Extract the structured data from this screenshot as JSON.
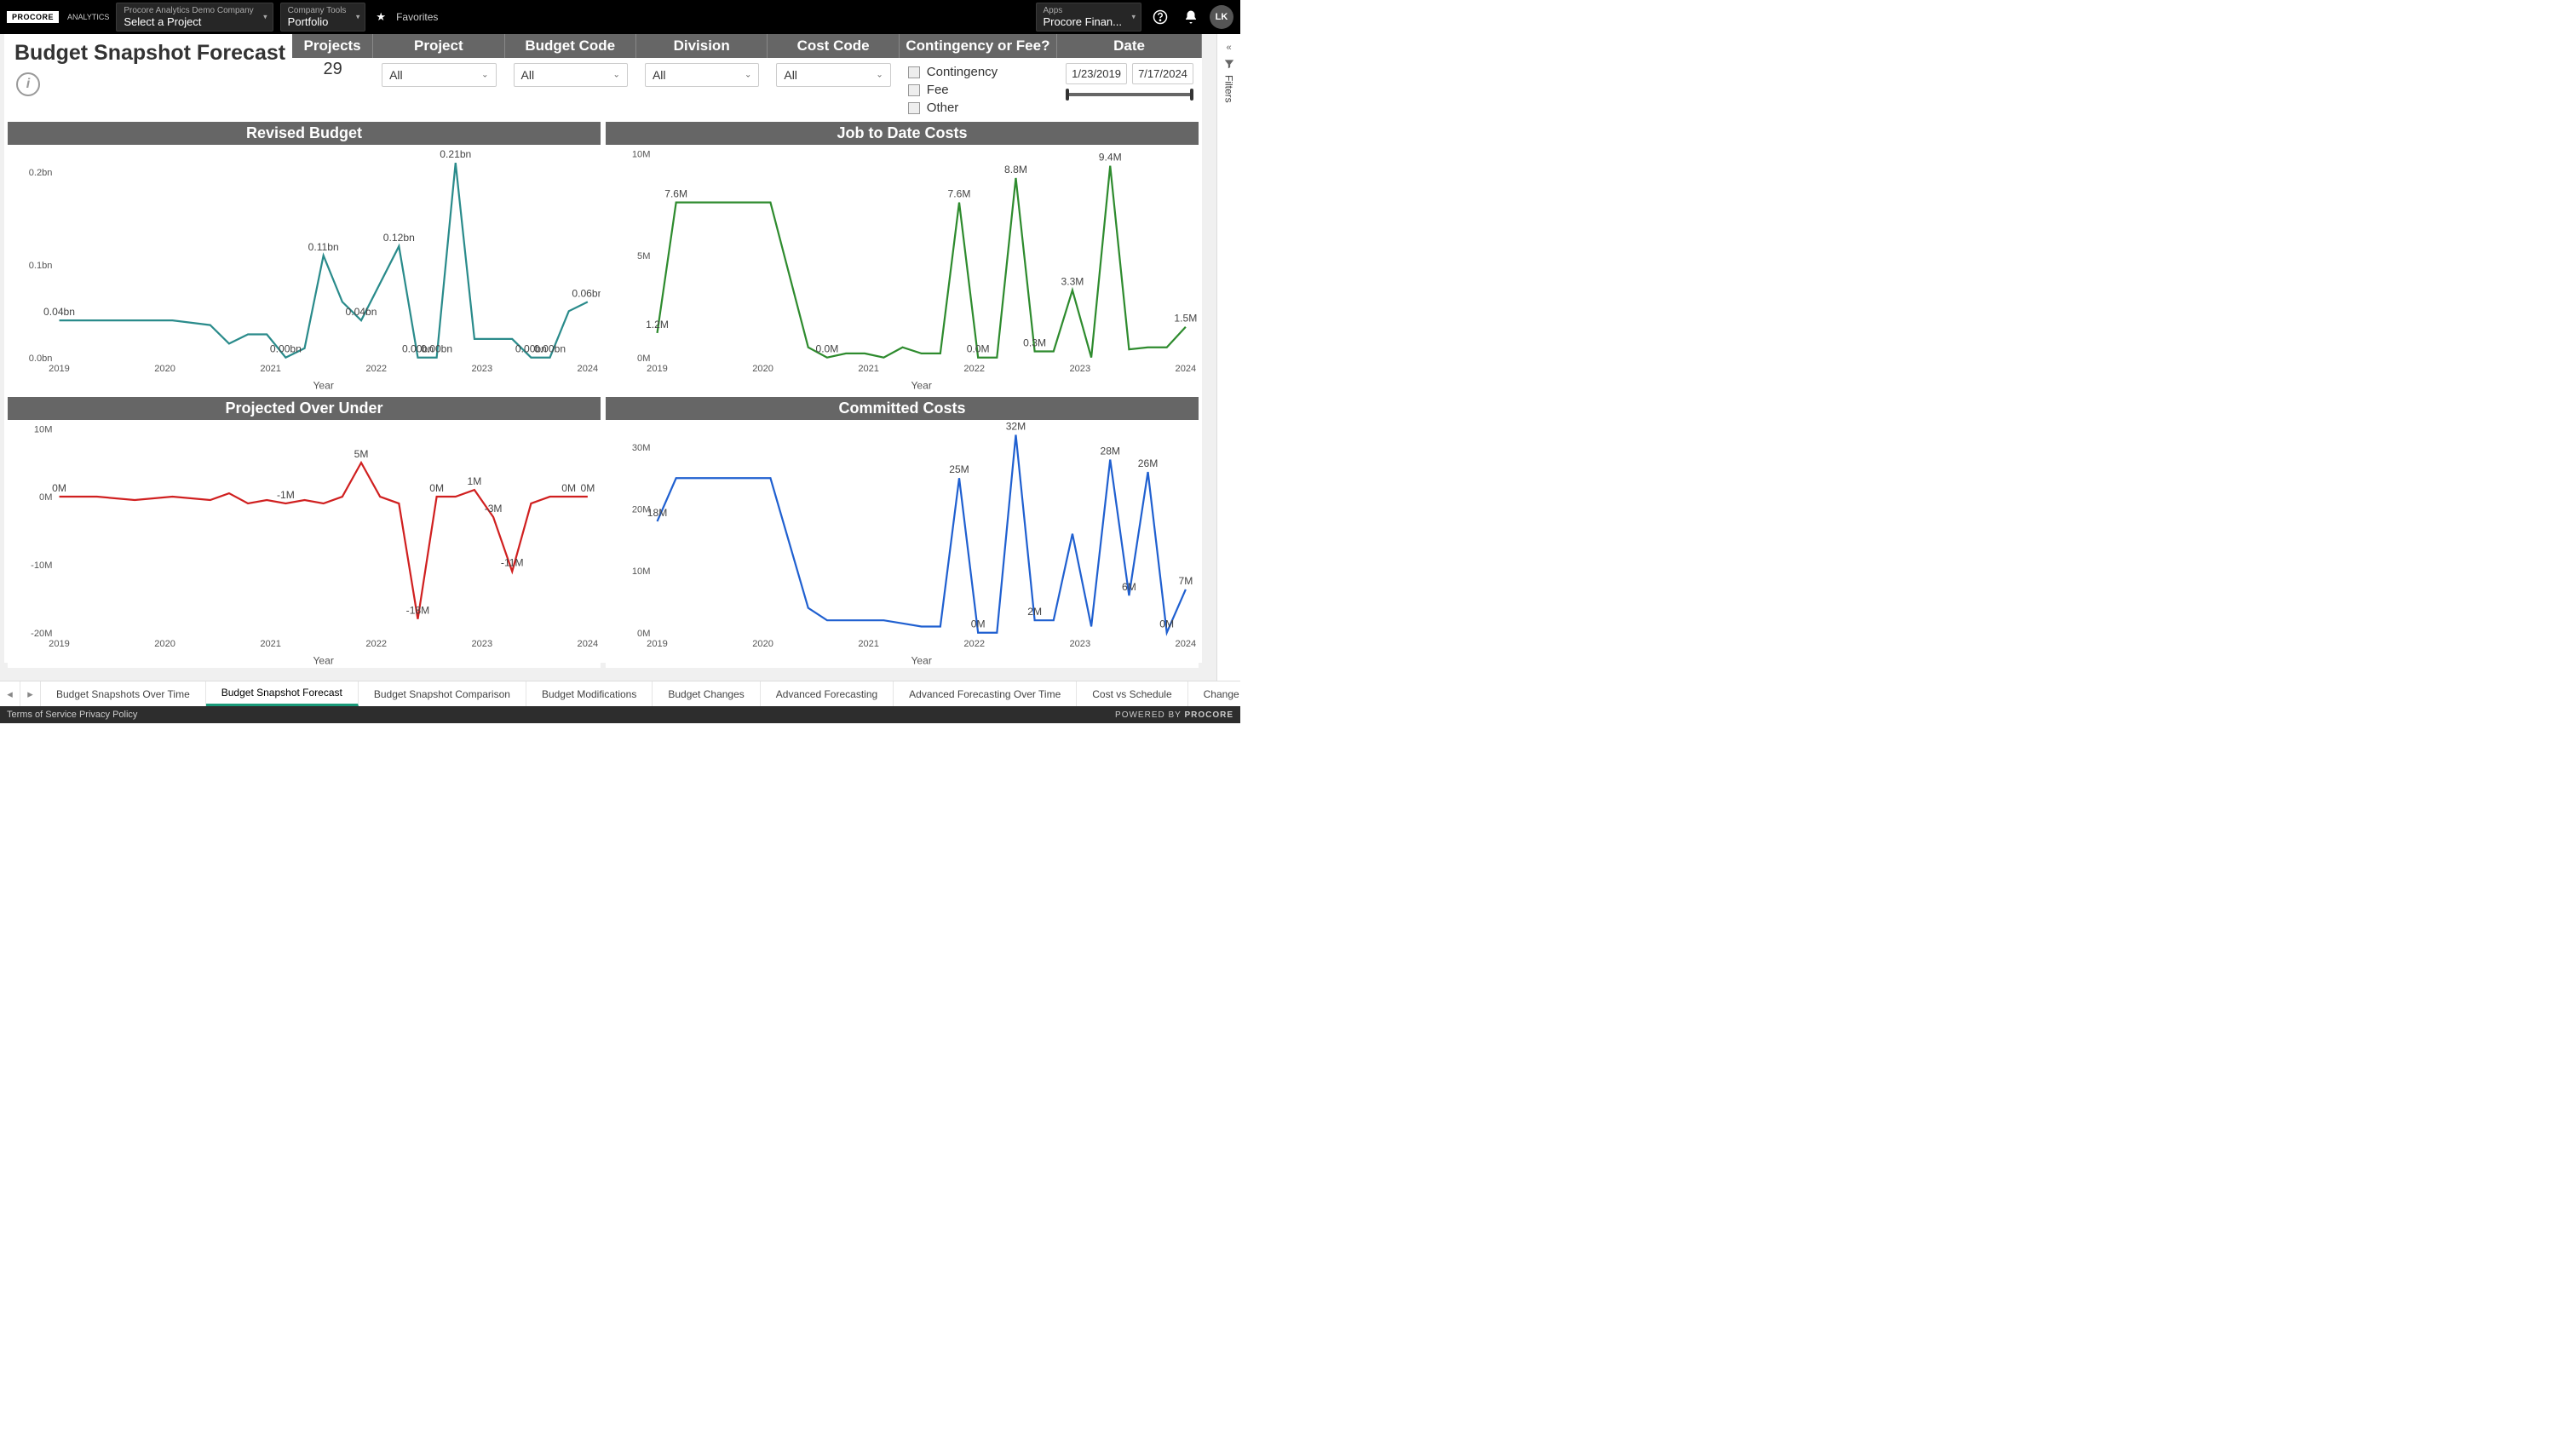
{
  "topbar": {
    "logo": "PROCORE",
    "logo_sub": "ANALYTICS",
    "company_dd": {
      "label": "Procore Analytics Demo Company",
      "value": "Select a Project"
    },
    "tools_dd": {
      "label": "Company Tools",
      "value": "Portfolio"
    },
    "favorites": "Favorites",
    "apps_dd": {
      "label": "Apps",
      "value": "Procore Finan..."
    },
    "avatar": "LK"
  },
  "page_title": "Budget Snapshot Forecast",
  "filters": {
    "projects": {
      "header": "Projects",
      "count": "29"
    },
    "project": {
      "header": "Project",
      "value": "All"
    },
    "budget_code": {
      "header": "Budget Code",
      "value": "All"
    },
    "division": {
      "header": "Division",
      "value": "All"
    },
    "cost_code": {
      "header": "Cost Code",
      "value": "All"
    },
    "contingency": {
      "header": "Contingency or Fee?",
      "options": [
        "Contingency",
        "Fee",
        "Other"
      ]
    },
    "date": {
      "header": "Date",
      "from": "1/23/2019",
      "to": "7/17/2024"
    }
  },
  "filters_pane": "Filters",
  "chart_data": [
    {
      "id": "revised_budget",
      "title": "Revised Budget",
      "type": "line",
      "color": "#2a8b8b",
      "xlabel": "Year",
      "ylabel": "",
      "ylim": [
        0,
        0.22
      ],
      "yticks": [
        0.0,
        0.1,
        0.2
      ],
      "ytick_labels": [
        "0.0bn",
        "0.1bn",
        "0.2bn"
      ],
      "xticks": [
        "2019",
        "2020",
        "2021",
        "2022",
        "2023",
        "2024"
      ],
      "x": [
        0,
        1,
        2,
        3,
        4,
        4.5,
        5,
        5.5,
        6,
        6.5,
        7,
        7.5,
        8,
        9,
        9.5,
        10,
        10.5,
        11,
        12,
        12.5,
        13,
        13.5,
        14
      ],
      "y": [
        0.04,
        0.04,
        0.04,
        0.04,
        0.035,
        0.015,
        0.025,
        0.025,
        0.0,
        0.01,
        0.11,
        0.06,
        0.04,
        0.12,
        0.0,
        0.0,
        0.21,
        0.02,
        0.02,
        0.0,
        0.0,
        0.05,
        0.06
      ],
      "point_labels": {
        "0": "0.04bn",
        "8": "0.00bn",
        "10": "0.11bn",
        "12": "0.04bn",
        "13": "0.12bn",
        "14": "0.00bn",
        "15": "0.00bn",
        "16": "0.21bn",
        "19": "0.00bn",
        "20": "0.00bn",
        "22": "0.06bn"
      }
    },
    {
      "id": "jtd_costs",
      "title": "Job to Date Costs",
      "type": "line",
      "color": "#2e8b2e",
      "xlabel": "Year",
      "ylim": [
        0,
        10
      ],
      "yticks": [
        0,
        5,
        10
      ],
      "ytick_labels": [
        "0M",
        "5M",
        "10M"
      ],
      "xticks": [
        "2019",
        "2020",
        "2021",
        "2022",
        "2023",
        "2024"
      ],
      "x": [
        0,
        0.5,
        1,
        2,
        3,
        4,
        4.5,
        5,
        5.5,
        6,
        6.5,
        7,
        7.5,
        8,
        8.5,
        9,
        9.5,
        10,
        10.5,
        11,
        11.5,
        12,
        12.5,
        13,
        13.5,
        14
      ],
      "y": [
        1.2,
        7.6,
        7.6,
        7.6,
        7.6,
        0.5,
        0.0,
        0.2,
        0.2,
        0.0,
        0.5,
        0.2,
        0.2,
        7.6,
        0.0,
        0.0,
        8.8,
        0.3,
        0.3,
        3.3,
        0.0,
        9.4,
        0.4,
        0.5,
        0.5,
        1.5
      ],
      "point_labels": {
        "0": "1.2M",
        "1": "7.6M",
        "6": "0.0M",
        "8": "",
        "13": "7.6M",
        "14": "0.0M",
        "16": "8.8M",
        "17": "0.3M",
        "19": "3.3M",
        "21": "9.4M",
        "25": "1.5M"
      }
    },
    {
      "id": "proj_over_under",
      "title": "Projected Over Under",
      "type": "line",
      "color": "#d02020",
      "xlabel": "Year",
      "ylim": [
        -20,
        10
      ],
      "yticks": [
        -20,
        -10,
        0,
        10
      ],
      "ytick_labels": [
        "-20M",
        "-10M",
        "0M",
        "10M"
      ],
      "xticks": [
        "2019",
        "2020",
        "2021",
        "2022",
        "2023",
        "2024"
      ],
      "x": [
        0,
        1,
        2,
        3,
        4,
        4.5,
        5,
        5.5,
        6,
        6.5,
        7,
        7.5,
        8,
        8.5,
        9,
        9.5,
        10,
        10.5,
        11,
        11.5,
        12,
        12.5,
        13,
        13.5,
        14
      ],
      "y": [
        0,
        0,
        -0.5,
        0,
        -0.5,
        0.5,
        -1,
        -0.5,
        -1,
        -0.5,
        -1,
        0,
        5,
        0,
        -1,
        -18,
        0,
        0,
        1,
        -3,
        -11,
        -1,
        0,
        0,
        0
      ],
      "point_labels": {
        "0": "0M",
        "8": "-1M",
        "12": "5M",
        "15": "-18M",
        "16": "0M",
        "18": "1M",
        "19": "-3M",
        "20": "-11M",
        "23": "0M",
        "24": "0M"
      }
    },
    {
      "id": "committed_costs",
      "title": "Committed Costs",
      "type": "line",
      "color": "#2060d0",
      "xlabel": "Year",
      "ylim": [
        0,
        33
      ],
      "yticks": [
        0,
        10,
        20,
        30
      ],
      "ytick_labels": [
        "0M",
        "10M",
        "20M",
        "30M"
      ],
      "xticks": [
        "2019",
        "2020",
        "2021",
        "2022",
        "2023",
        "2024"
      ],
      "x": [
        0,
        0.5,
        1,
        2,
        3,
        4,
        4.5,
        5,
        5.5,
        6,
        6.5,
        7,
        7.5,
        8,
        8.5,
        9,
        9.5,
        10,
        10.5,
        11,
        11.5,
        12,
        12.5,
        13,
        13.5,
        14
      ],
      "y": [
        18,
        25,
        25,
        25,
        25,
        4,
        2,
        2,
        2,
        2,
        1.5,
        1,
        1,
        25,
        0,
        0,
        32,
        2,
        2,
        16,
        1,
        28,
        6,
        26,
        0,
        7
      ],
      "point_labels": {
        "0": "18M",
        "13": "25M",
        "14": "0M",
        "16": "32M",
        "17": "2M",
        "21": "28M",
        "22": "6M",
        "23": "26M",
        "24": "0M",
        "25": "7M"
      }
    }
  ],
  "tabs": [
    "Budget Snapshots Over Time",
    "Budget Snapshot Forecast",
    "Budget Snapshot Comparison",
    "Budget Modifications",
    "Budget Changes",
    "Advanced Forecasting",
    "Advanced Forecasting Over Time",
    "Cost vs Schedule",
    "Change Events"
  ],
  "active_tab": 1,
  "footer": {
    "left": "Terms of Service  Privacy Policy",
    "right": "POWERED BY PROCORE"
  }
}
